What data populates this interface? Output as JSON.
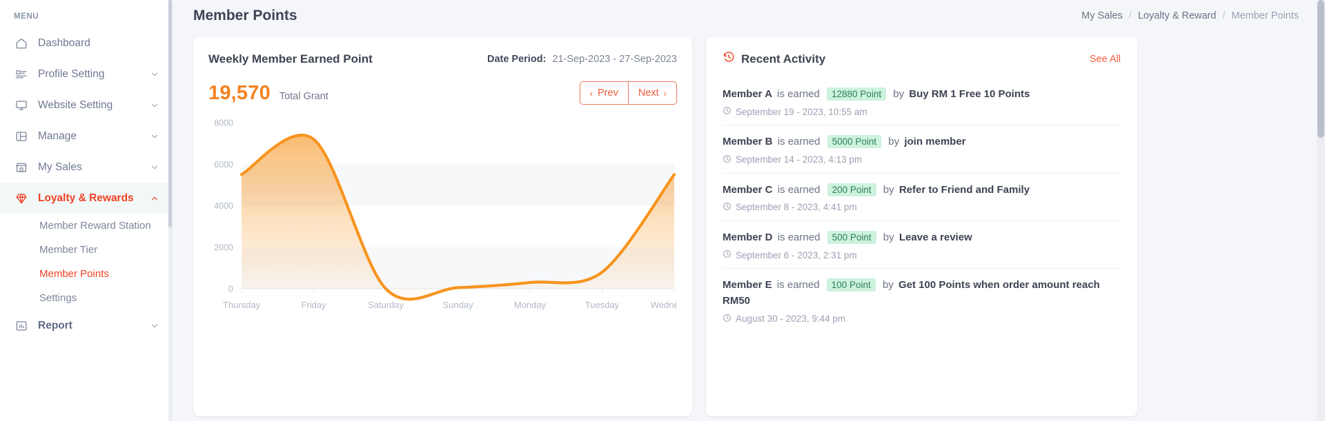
{
  "sidebar": {
    "menu_label": "MENU",
    "items": [
      {
        "label": "Dashboard",
        "icon": "home-icon",
        "expandable": false,
        "active": false
      },
      {
        "label": "Profile Setting",
        "icon": "profile-icon",
        "expandable": true,
        "active": false
      },
      {
        "label": "Website Setting",
        "icon": "monitor-icon",
        "expandable": true,
        "active": false
      },
      {
        "label": "Manage",
        "icon": "layout-icon",
        "expandable": true,
        "active": false
      },
      {
        "label": "My Sales",
        "icon": "store-icon",
        "expandable": true,
        "active": false
      },
      {
        "label": "Loyalty & Rewards",
        "icon": "diamond-icon",
        "expandable": true,
        "active": true
      }
    ],
    "subitems": [
      {
        "label": "Member Reward Station",
        "active": false
      },
      {
        "label": "Member Tier",
        "active": false
      },
      {
        "label": "Member Points",
        "active": true
      },
      {
        "label": "Settings",
        "active": false
      }
    ],
    "report": {
      "label": "Report",
      "icon": "chart-bar-icon",
      "expandable": true
    }
  },
  "header": {
    "title": "Member Points",
    "breadcrumb": [
      {
        "label": "My Sales",
        "current": false
      },
      {
        "label": "Loyalty & Reward",
        "current": false
      },
      {
        "label": "Member Points",
        "current": true
      }
    ],
    "separator": "/"
  },
  "chart_card": {
    "title": "Weekly Member Earned Point",
    "date_period_label": "Date Period:",
    "date_period_value": "21-Sep-2023 - 27-Sep-2023",
    "total_value": "19,570",
    "total_label": "Total Grant",
    "prev_label": "Prev",
    "next_label": "Next",
    "prev_chevron": "‹",
    "next_chevron": "›"
  },
  "chart_data": {
    "type": "area",
    "title": "Weekly Member Earned Point",
    "xlabel": "",
    "ylabel": "",
    "categories": [
      "Thursday",
      "Friday",
      "Saturday",
      "Sunday",
      "Monday",
      "Tuesday",
      "Wednesday"
    ],
    "values": [
      5500,
      7200,
      0,
      50,
      300,
      800,
      5500
    ],
    "ylim": [
      0,
      8000
    ],
    "yticks": [
      0,
      2000,
      4000,
      6000,
      8000
    ],
    "ytick_labels": [
      "0",
      "2000",
      "4000",
      "6000",
      "8000"
    ],
    "grid": true,
    "legend": false,
    "line_color": "#f7941e",
    "fill_color": "#f7941e",
    "total": 19570
  },
  "activity": {
    "title": "Recent Activity",
    "see_all_label": "See All",
    "items": [
      {
        "member": "Member A",
        "verb": "is earned",
        "points": "12880 Point",
        "by": "by",
        "reason": "Buy RM 1 Free 10 Points",
        "time": "September 19 - 2023, 10:55 am"
      },
      {
        "member": "Member B",
        "verb": "is earned",
        "points": "5000 Point",
        "by": "by",
        "reason": "join member",
        "time": "September 14 - 2023, 4:13 pm"
      },
      {
        "member": "Member C",
        "verb": "is earned",
        "points": "200 Point",
        "by": "by",
        "reason": "Refer to Friend and Family",
        "time": "September 8 - 2023, 4:41 pm"
      },
      {
        "member": "Member D",
        "verb": "is earned",
        "points": "500 Point",
        "by": "by",
        "reason": "Leave a review",
        "time": "September 6 - 2023, 2:31 pm"
      },
      {
        "member": "Member E",
        "verb": "is earned",
        "points": "100 Point",
        "by": "by",
        "reason": "Get 100 Points when order amount reach RM50",
        "time": "August 30 - 2023, 9:44 pm"
      }
    ]
  },
  "colors": {
    "accent": "#f04124",
    "chart_orange": "#f7941e",
    "badge_bg": "#cdf2de",
    "badge_text": "#2f7f55",
    "page_bg": "#f4f6f9"
  }
}
